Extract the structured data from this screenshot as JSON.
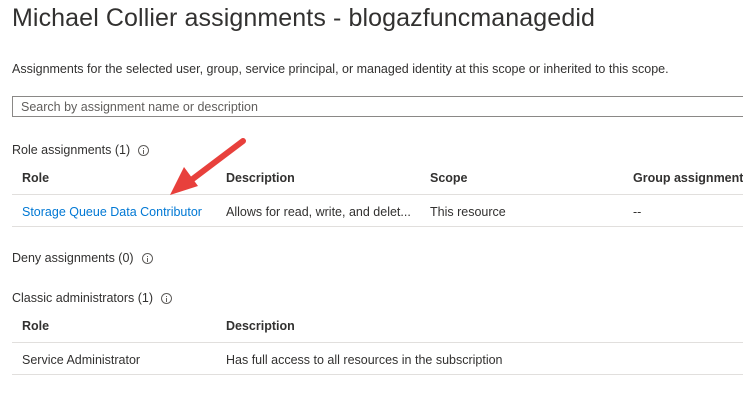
{
  "header": {
    "title": "Michael Collier assignments - blogazfuncmanagedid",
    "subtitle": "Assignments for the selected user, group, service principal, or managed identity at this scope or inherited to this scope."
  },
  "search": {
    "placeholder": "Search by assignment name or description",
    "value": ""
  },
  "role_assignments": {
    "label": "Role assignments (1)",
    "columns": [
      "Role",
      "Description",
      "Scope",
      "Group assignment"
    ],
    "rows": [
      {
        "role": "Storage Queue Data Contributor",
        "description": "Allows for read, write, and delet...",
        "scope": "This resource",
        "group_assignment": "--"
      }
    ]
  },
  "deny_assignments": {
    "label": "Deny assignments (0)"
  },
  "classic_administrators": {
    "label": "Classic administrators (1)",
    "columns": [
      "Role",
      "Description"
    ],
    "rows": [
      {
        "role": "Service Administrator",
        "description": "Has full access to all resources in the subscription"
      }
    ]
  },
  "colors": {
    "text": "#323130",
    "link": "#0078d4",
    "divider": "#e1dfdd",
    "annotation_arrow": "#e8403c"
  },
  "icons": [
    "info-icon",
    "red-arrow-annotation"
  ]
}
